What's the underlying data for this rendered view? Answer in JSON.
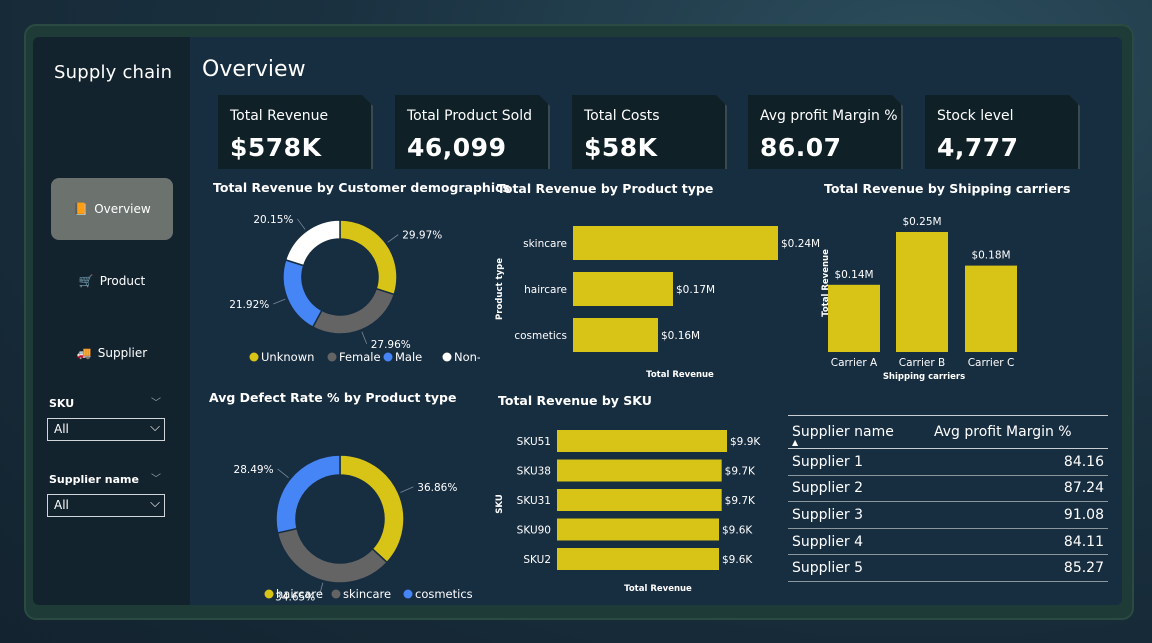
{
  "sidebar": {
    "title": "Supply chain",
    "nav": [
      {
        "label": "Overview",
        "icon": "📙"
      },
      {
        "label": "Product",
        "icon": "🛒"
      },
      {
        "label": "Supplier",
        "icon": "🚚"
      }
    ],
    "filters": [
      {
        "label": "SKU",
        "value": "All"
      },
      {
        "label": "Supplier name",
        "value": "All"
      }
    ]
  },
  "main": {
    "title": "Overview",
    "kpis": [
      {
        "label": "Total Revenue",
        "value": "$578K"
      },
      {
        "label": "Total Product Sold",
        "value": "46,099"
      },
      {
        "label": "Total Costs",
        "value": "$58K"
      },
      {
        "label": "Avg profit Margin %",
        "value": "86.07"
      },
      {
        "label": "Stock level",
        "value": "4,777"
      }
    ],
    "table": {
      "headers": [
        "Supplier name",
        "Avg profit Margin %"
      ],
      "rows": [
        [
          "Supplier 1",
          "84.16"
        ],
        [
          "Supplier 2",
          "87.24"
        ],
        [
          "Supplier 3",
          "91.08"
        ],
        [
          "Supplier 4",
          "84.11"
        ],
        [
          "Supplier 5",
          "85.27"
        ]
      ]
    }
  },
  "colors": {
    "yellow": "#d8c317",
    "gray": "#646464",
    "blue": "#4585f5",
    "white": "#ffffff"
  },
  "chart_data": [
    {
      "id": "demographics",
      "type": "pie",
      "title": "Total Revenue by Customer demographics",
      "categories": [
        "Unknown",
        "Female",
        "Male",
        "Non-binary"
      ],
      "values": [
        29.97,
        27.96,
        21.92,
        20.15
      ],
      "value_labels": [
        "29.97%",
        "27.96%",
        "21.92%",
        "20.15%"
      ],
      "legend": "bottom"
    },
    {
      "id": "product_type",
      "type": "bar",
      "title": "Total Revenue by Product type",
      "categories": [
        "skincare",
        "haircare",
        "cosmetics"
      ],
      "values": [
        0.24,
        0.17,
        0.16
      ],
      "value_labels": [
        "$0.24M",
        "$0.17M",
        "$0.16M"
      ],
      "xlabel": "Total Revenue",
      "ylabel": "Product type"
    },
    {
      "id": "carriers",
      "type": "bar",
      "title": "Total Revenue by Shipping carriers",
      "categories": [
        "Carrier A",
        "Carrier B",
        "Carrier C"
      ],
      "values": [
        0.14,
        0.25,
        0.18
      ],
      "value_labels": [
        "$0.14M",
        "$0.25M",
        "$0.18M"
      ],
      "xlabel": "Shipping carriers",
      "ylabel": "Total Revenue"
    },
    {
      "id": "defect",
      "type": "pie",
      "title": "Avg Defect Rate % by Product type",
      "categories": [
        "haircare",
        "skincare",
        "cosmetics"
      ],
      "values": [
        36.86,
        34.65,
        28.49
      ],
      "value_labels": [
        "36.86%",
        "34.65%",
        "28.49%"
      ],
      "legend": "bottom"
    },
    {
      "id": "sku",
      "type": "bar",
      "title": "Total Revenue by SKU",
      "categories": [
        "SKU51",
        "SKU38",
        "SKU31",
        "SKU90",
        "SKU2"
      ],
      "values": [
        9.9,
        9.7,
        9.7,
        9.6,
        9.6
      ],
      "value_labels": [
        "$9.9K",
        "$9.7K",
        "$9.7K",
        "$9.6K",
        "$9.6K"
      ],
      "xlabel": "Total Revenue",
      "ylabel": "SKU"
    }
  ]
}
